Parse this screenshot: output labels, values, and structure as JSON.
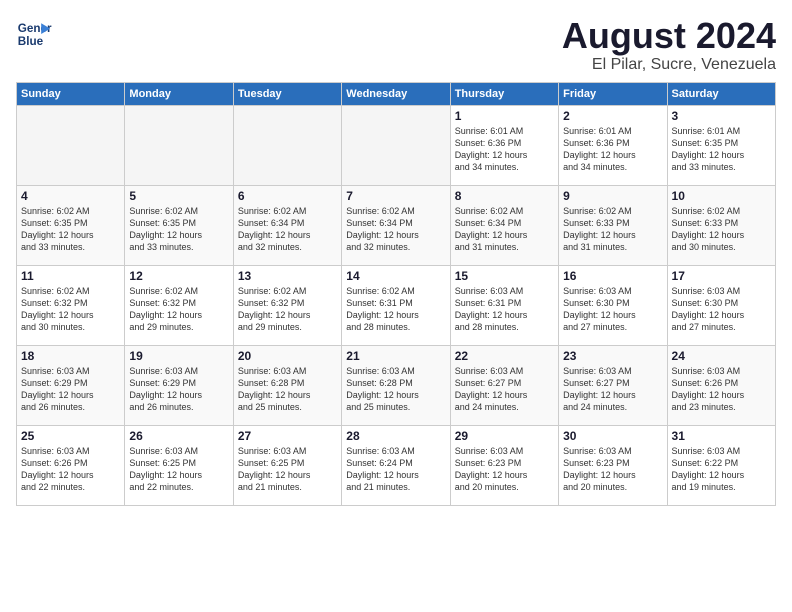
{
  "logo": {
    "line1": "General",
    "line2": "Blue"
  },
  "title": "August 2024",
  "subtitle": "El Pilar, Sucre, Venezuela",
  "days_of_week": [
    "Sunday",
    "Monday",
    "Tuesday",
    "Wednesday",
    "Thursday",
    "Friday",
    "Saturday"
  ],
  "weeks": [
    [
      {
        "day": "",
        "detail": ""
      },
      {
        "day": "",
        "detail": ""
      },
      {
        "day": "",
        "detail": ""
      },
      {
        "day": "",
        "detail": ""
      },
      {
        "day": "1",
        "detail": "Sunrise: 6:01 AM\nSunset: 6:36 PM\nDaylight: 12 hours\nand 34 minutes."
      },
      {
        "day": "2",
        "detail": "Sunrise: 6:01 AM\nSunset: 6:36 PM\nDaylight: 12 hours\nand 34 minutes."
      },
      {
        "day": "3",
        "detail": "Sunrise: 6:01 AM\nSunset: 6:35 PM\nDaylight: 12 hours\nand 33 minutes."
      }
    ],
    [
      {
        "day": "4",
        "detail": "Sunrise: 6:02 AM\nSunset: 6:35 PM\nDaylight: 12 hours\nand 33 minutes."
      },
      {
        "day": "5",
        "detail": "Sunrise: 6:02 AM\nSunset: 6:35 PM\nDaylight: 12 hours\nand 33 minutes."
      },
      {
        "day": "6",
        "detail": "Sunrise: 6:02 AM\nSunset: 6:34 PM\nDaylight: 12 hours\nand 32 minutes."
      },
      {
        "day": "7",
        "detail": "Sunrise: 6:02 AM\nSunset: 6:34 PM\nDaylight: 12 hours\nand 32 minutes."
      },
      {
        "day": "8",
        "detail": "Sunrise: 6:02 AM\nSunset: 6:34 PM\nDaylight: 12 hours\nand 31 minutes."
      },
      {
        "day": "9",
        "detail": "Sunrise: 6:02 AM\nSunset: 6:33 PM\nDaylight: 12 hours\nand 31 minutes."
      },
      {
        "day": "10",
        "detail": "Sunrise: 6:02 AM\nSunset: 6:33 PM\nDaylight: 12 hours\nand 30 minutes."
      }
    ],
    [
      {
        "day": "11",
        "detail": "Sunrise: 6:02 AM\nSunset: 6:32 PM\nDaylight: 12 hours\nand 30 minutes."
      },
      {
        "day": "12",
        "detail": "Sunrise: 6:02 AM\nSunset: 6:32 PM\nDaylight: 12 hours\nand 29 minutes."
      },
      {
        "day": "13",
        "detail": "Sunrise: 6:02 AM\nSunset: 6:32 PM\nDaylight: 12 hours\nand 29 minutes."
      },
      {
        "day": "14",
        "detail": "Sunrise: 6:02 AM\nSunset: 6:31 PM\nDaylight: 12 hours\nand 28 minutes."
      },
      {
        "day": "15",
        "detail": "Sunrise: 6:03 AM\nSunset: 6:31 PM\nDaylight: 12 hours\nand 28 minutes."
      },
      {
        "day": "16",
        "detail": "Sunrise: 6:03 AM\nSunset: 6:30 PM\nDaylight: 12 hours\nand 27 minutes."
      },
      {
        "day": "17",
        "detail": "Sunrise: 6:03 AM\nSunset: 6:30 PM\nDaylight: 12 hours\nand 27 minutes."
      }
    ],
    [
      {
        "day": "18",
        "detail": "Sunrise: 6:03 AM\nSunset: 6:29 PM\nDaylight: 12 hours\nand 26 minutes."
      },
      {
        "day": "19",
        "detail": "Sunrise: 6:03 AM\nSunset: 6:29 PM\nDaylight: 12 hours\nand 26 minutes."
      },
      {
        "day": "20",
        "detail": "Sunrise: 6:03 AM\nSunset: 6:28 PM\nDaylight: 12 hours\nand 25 minutes."
      },
      {
        "day": "21",
        "detail": "Sunrise: 6:03 AM\nSunset: 6:28 PM\nDaylight: 12 hours\nand 25 minutes."
      },
      {
        "day": "22",
        "detail": "Sunrise: 6:03 AM\nSunset: 6:27 PM\nDaylight: 12 hours\nand 24 minutes."
      },
      {
        "day": "23",
        "detail": "Sunrise: 6:03 AM\nSunset: 6:27 PM\nDaylight: 12 hours\nand 24 minutes."
      },
      {
        "day": "24",
        "detail": "Sunrise: 6:03 AM\nSunset: 6:26 PM\nDaylight: 12 hours\nand 23 minutes."
      }
    ],
    [
      {
        "day": "25",
        "detail": "Sunrise: 6:03 AM\nSunset: 6:26 PM\nDaylight: 12 hours\nand 22 minutes."
      },
      {
        "day": "26",
        "detail": "Sunrise: 6:03 AM\nSunset: 6:25 PM\nDaylight: 12 hours\nand 22 minutes."
      },
      {
        "day": "27",
        "detail": "Sunrise: 6:03 AM\nSunset: 6:25 PM\nDaylight: 12 hours\nand 21 minutes."
      },
      {
        "day": "28",
        "detail": "Sunrise: 6:03 AM\nSunset: 6:24 PM\nDaylight: 12 hours\nand 21 minutes."
      },
      {
        "day": "29",
        "detail": "Sunrise: 6:03 AM\nSunset: 6:23 PM\nDaylight: 12 hours\nand 20 minutes."
      },
      {
        "day": "30",
        "detail": "Sunrise: 6:03 AM\nSunset: 6:23 PM\nDaylight: 12 hours\nand 20 minutes."
      },
      {
        "day": "31",
        "detail": "Sunrise: 6:03 AM\nSunset: 6:22 PM\nDaylight: 12 hours\nand 19 minutes."
      }
    ]
  ]
}
